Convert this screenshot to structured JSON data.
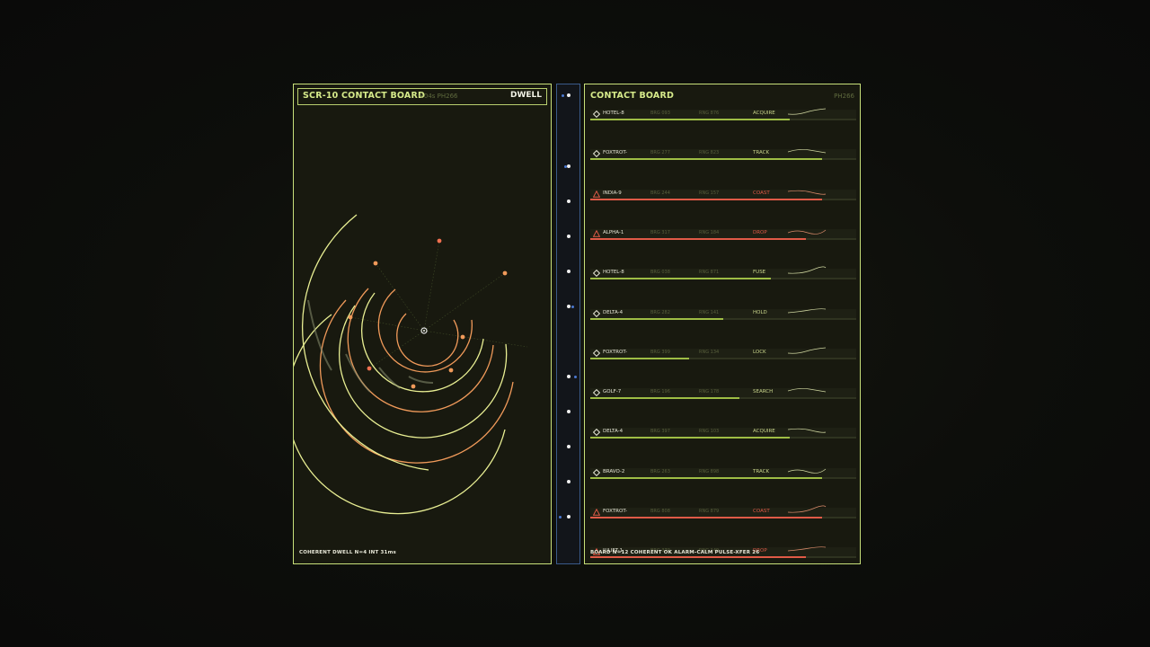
{
  "left": {
    "title": "SCR-10  CONTACT BOARD",
    "sub": "+04s  PH266",
    "mode": "DWELL",
    "footer": "COHERENT DWELL  N=4  INT 31ms"
  },
  "right": {
    "title": "CONTACT BOARD",
    "sub": "PH266",
    "footer": "BOARD N=12  COHERENT OK  ALARM-CALM  PULSE-XFER 26"
  },
  "colors": {
    "accent": "#c8e07a",
    "green": "#9ebd45",
    "red": "#e05a47",
    "orange": "#f09a5a",
    "rail": "#3a5a8a"
  },
  "contacts": [
    {
      "name": "HOTEL-8",
      "brg": "BRG 093",
      "rng": "RNG 876",
      "status": "ACQUIRE",
      "alert": false,
      "level": 0.75
    },
    {
      "name": "FOXTROT-",
      "brg": "BRG 277",
      "rng": "RNG 823",
      "status": "TRACK",
      "alert": false,
      "level": 0.87
    },
    {
      "name": "INDIA-9",
      "brg": "BRG 244",
      "rng": "RNG 157",
      "status": "COAST",
      "alert": true,
      "level": 0.87
    },
    {
      "name": "ALPHA-1",
      "brg": "BRG 317",
      "rng": "RNG 184",
      "status": "DROP",
      "alert": true,
      "level": 0.81
    },
    {
      "name": "HOTEL-8",
      "brg": "BRG 038",
      "rng": "RNG 871",
      "status": "FUSE",
      "alert": false,
      "level": 0.68
    },
    {
      "name": "DELTA-4",
      "brg": "BRG 282",
      "rng": "RNG 141",
      "status": "HOLD",
      "alert": false,
      "level": 0.5
    },
    {
      "name": "FOXTROT-",
      "brg": "BRG 399",
      "rng": "RNG 134",
      "status": "LOCK",
      "alert": false,
      "level": 0.37
    },
    {
      "name": "GOLF-7",
      "brg": "BRG 196",
      "rng": "RNG 178",
      "status": "SEARCH",
      "alert": false,
      "level": 0.56
    },
    {
      "name": "DELTA-4",
      "brg": "BRG 397",
      "rng": "RNG 103",
      "status": "ACQUIRE",
      "alert": false,
      "level": 0.75
    },
    {
      "name": "BRAVO-2",
      "brg": "BRG 263",
      "rng": "RNG 898",
      "status": "TRACK",
      "alert": false,
      "level": 0.87
    },
    {
      "name": "FOXTROT-",
      "brg": "BRG 808",
      "rng": "RNG 879",
      "status": "COAST",
      "alert": true,
      "level": 0.87
    },
    {
      "name": "JULIET-1",
      "brg": "BRG 370",
      "rng": "RNG 149",
      "status": "DROP",
      "alert": true,
      "level": 0.81
    }
  ]
}
